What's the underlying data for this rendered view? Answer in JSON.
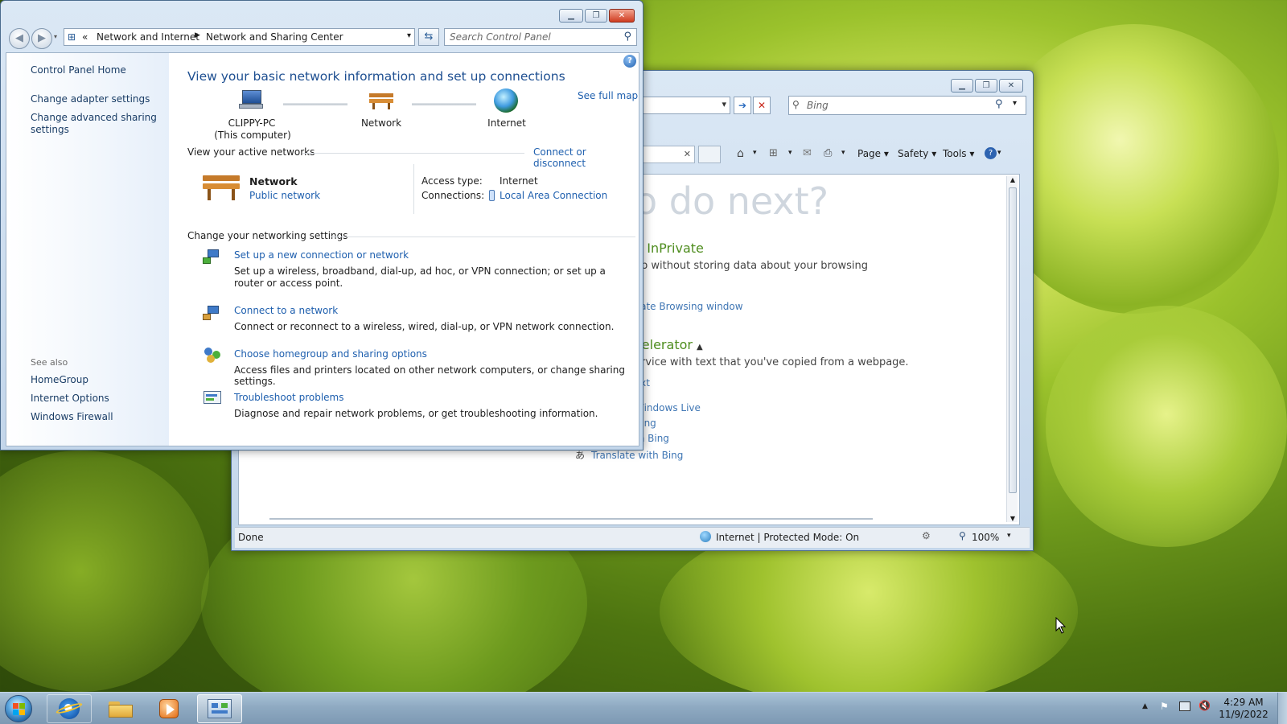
{
  "desktop": {
    "accent": "#8cbf2a"
  },
  "taskbar": {
    "items": [
      {
        "name": "start-button",
        "icon": "windows-orb-icon"
      },
      {
        "name": "internet-explorer",
        "icon": "ie-icon"
      },
      {
        "name": "windows-explorer",
        "icon": "folder-icon"
      },
      {
        "name": "media-player",
        "icon": "media-player-icon"
      },
      {
        "name": "control-panel",
        "icon": "control-panel-icon",
        "active": true
      }
    ],
    "clock": {
      "time": "4:29 AM",
      "date": "11/9/2022"
    }
  },
  "ie": {
    "address_dropdown": "▾",
    "search": {
      "placeholder": "Bing"
    },
    "command_bar": {
      "page": "Page",
      "safety": "Safety",
      "tools": "Tools"
    },
    "content": {
      "heading": "o do next?",
      "inprivate_title": "h InPrivate",
      "inprivate_desc": "eb without storing data about your browsing",
      "inprivate_link": "vate Browsing window",
      "accelerator_title": "celerator",
      "accelerator_desc": "ervice with text that you've copied from a webpage.",
      "accelerator_links": [
        "ext",
        "Windows Live",
        "Bing",
        "th Bing"
      ],
      "translate": "Translate with Bing"
    },
    "status": {
      "text": "Done",
      "zone": "Internet | Protected Mode: On",
      "zoom": "100%"
    }
  },
  "cp": {
    "breadcrumb": {
      "chevrons": "«",
      "part1": "Network and Internet",
      "part2": "Network and Sharing Center"
    },
    "search": {
      "placeholder": "Search Control Panel"
    },
    "left": {
      "home": "Control Panel Home",
      "tasks": [
        "Change adapter settings",
        "Change advanced sharing settings"
      ],
      "see_also_title": "See also",
      "see_also": [
        "HomeGroup",
        "Internet Options",
        "Windows Firewall"
      ]
    },
    "main": {
      "title": "View your basic network information and set up connections",
      "see_full_map": "See full map",
      "map": {
        "computer": "CLIPPY-PC",
        "computer_sub": "(This computer)",
        "network": "Network",
        "internet": "Internet"
      },
      "active_title": "View your active networks",
      "connect_disconnect": "Connect or disconnect",
      "active_network": {
        "name": "Network",
        "type": "Public network",
        "access_label": "Access type:",
        "access_value": "Internet",
        "connections_label": "Connections:",
        "connections_value": "Local Area Connection"
      },
      "settings_title": "Change your networking settings",
      "settings": [
        {
          "title": "Set up a new connection or network",
          "desc": "Set up a wireless, broadband, dial-up, ad hoc, or VPN connection; or set up a router or access point."
        },
        {
          "title": "Connect to a network",
          "desc": "Connect or reconnect to a wireless, wired, dial-up, or VPN network connection."
        },
        {
          "title": "Choose homegroup and sharing options",
          "desc": "Access files and printers located on other network computers, or change sharing settings."
        },
        {
          "title": "Troubleshoot problems",
          "desc": "Diagnose and repair network problems, or get troubleshooting information."
        }
      ]
    }
  }
}
